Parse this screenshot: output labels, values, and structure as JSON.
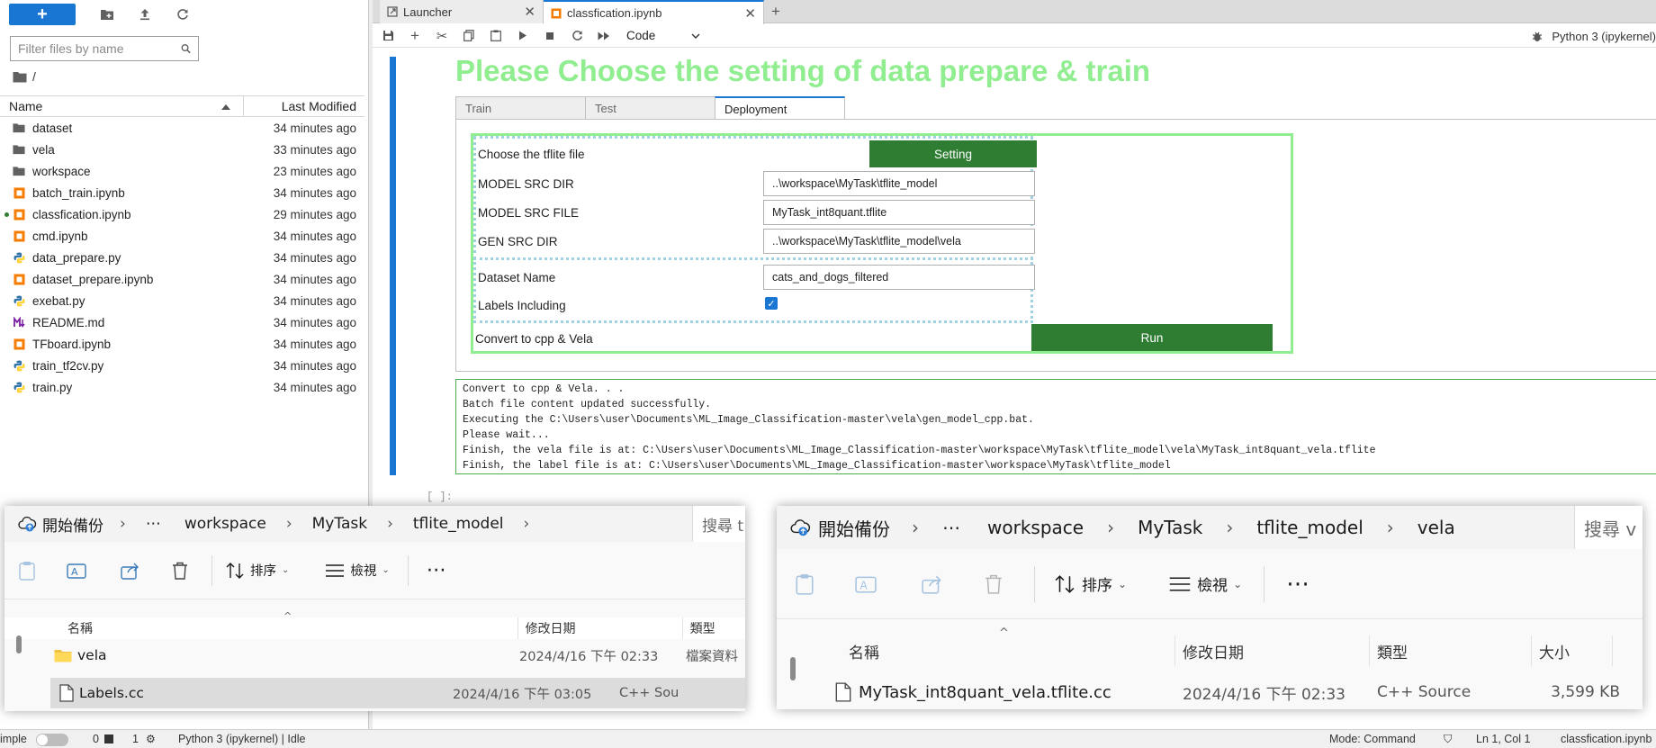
{
  "filebrowser": {
    "new_label": "+",
    "filter_placeholder": "Filter files by name",
    "path": "/",
    "col_name": "Name",
    "col_modified": "Last Modified",
    "files": [
      {
        "name": "dataset",
        "modified": "34 minutes ago",
        "kind": "folder"
      },
      {
        "name": "vela",
        "modified": "33 minutes ago",
        "kind": "folder"
      },
      {
        "name": "workspace",
        "modified": "23 minutes ago",
        "kind": "folder"
      },
      {
        "name": "batch_train.ipynb",
        "modified": "34 minutes ago",
        "kind": "notebook"
      },
      {
        "name": "classfication.ipynb",
        "modified": "29 minutes ago",
        "kind": "notebook",
        "running": true
      },
      {
        "name": "cmd.ipynb",
        "modified": "34 minutes ago",
        "kind": "notebook"
      },
      {
        "name": "data_prepare.py",
        "modified": "34 minutes ago",
        "kind": "python"
      },
      {
        "name": "dataset_prepare.ipynb",
        "modified": "34 minutes ago",
        "kind": "notebook"
      },
      {
        "name": "exebat.py",
        "modified": "34 minutes ago",
        "kind": "python"
      },
      {
        "name": "README.md",
        "modified": "34 minutes ago",
        "kind": "markdown"
      },
      {
        "name": "TFboard.ipynb",
        "modified": "34 minutes ago",
        "kind": "notebook"
      },
      {
        "name": "train_tf2cv.py",
        "modified": "34 minutes ago",
        "kind": "python"
      },
      {
        "name": "train.py",
        "modified": "34 minutes ago",
        "kind": "python"
      }
    ]
  },
  "tabs": [
    {
      "label": "Launcher",
      "active": false
    },
    {
      "label": "classfication.ipynb",
      "active": true
    }
  ],
  "toolbar": {
    "cell_type": "Code",
    "kernel": "Python 3 (ipykernel)"
  },
  "notebook": {
    "heading": "Please Choose the setting of data prepare & train",
    "widget_tabs": [
      "Train",
      "Test",
      "Deployment"
    ],
    "form": {
      "choose_label": "Choose the tflite file",
      "setting_button": "Setting",
      "model_src_dir_label": "MODEL SRC DIR",
      "model_src_dir_value": "..\\workspace\\MyTask\\tflite_model",
      "model_src_file_label": "MODEL SRC FILE",
      "model_src_file_value": "MyTask_int8quant.tflite",
      "gen_src_dir_label": "GEN SRC DIR",
      "gen_src_dir_value": "..\\workspace\\MyTask\\tflite_model\\vela",
      "dataset_name_label": "Dataset Name",
      "dataset_name_value": "cats_and_dogs_filtered",
      "labels_including_label": "Labels Including",
      "labels_including_checked": true,
      "convert_label": "Convert to cpp & Vela",
      "run_button": "Run"
    },
    "output_lines": [
      "Convert to cpp & Vela. . .",
      "Batch file content updated successfully.",
      "Executing the C:\\Users\\user\\Documents\\ML_Image_Classification-master\\vela\\gen_model_cpp.bat.",
      "Please wait...",
      "Finish, the vela file is at: C:\\Users\\user\\Documents\\ML_Image_Classification-master\\workspace\\MyTask\\tflite_model\\vela\\MyTask_int8quant_vela.tflite",
      "Finish, the label file is at: C:\\Users\\user\\Documents\\ML_Image_Classification-master\\workspace\\MyTask\\tflite_model"
    ],
    "next_prompt": "[ ]:"
  },
  "statusbar": {
    "mode_label": "imple",
    "count_a": "0",
    "count_b": "1",
    "kernel_status": "Python 3 (ipykernel) | Idle",
    "mode": "Mode: Command",
    "position": "Ln 1, Col 1",
    "filename": "classfication.ipynb"
  },
  "explorer_left": {
    "backup": "開始備份",
    "crumbs": [
      "workspace",
      "MyTask",
      "tflite_model"
    ],
    "search": "搜尋 t",
    "sort": "排序",
    "view": "檢視",
    "col_name": "名稱",
    "col_date": "修改日期",
    "col_type": "類型",
    "rows": [
      {
        "name": "vela",
        "date": "2024/4/16 下午 02:33",
        "type": "檔案資料",
        "kind": "folder"
      },
      {
        "name": "Labels.cc",
        "date": "2024/4/16 下午 03:05",
        "type": "C++ Sou",
        "kind": "cpp",
        "selected": true
      }
    ]
  },
  "explorer_right": {
    "backup": "開始備份",
    "crumbs": [
      "workspace",
      "MyTask",
      "tflite_model",
      "vela"
    ],
    "search": "搜尋 v",
    "sort": "排序",
    "view": "檢視",
    "col_name": "名稱",
    "col_date": "修改日期",
    "col_type": "類型",
    "col_size": "大小",
    "rows": [
      {
        "name": "MyTask_int8quant_vela.tflite.cc",
        "date": "2024/4/16 下午 02:33",
        "type": "C++ Source",
        "size": "3,599 KB",
        "kind": "cpp"
      }
    ]
  },
  "colors": {
    "accent_blue": "#1976d2",
    "heading_green": "#90ee90",
    "button_green": "#2e7d32",
    "output_border": "#4caf50",
    "notebook_icon": "#f57c00"
  }
}
